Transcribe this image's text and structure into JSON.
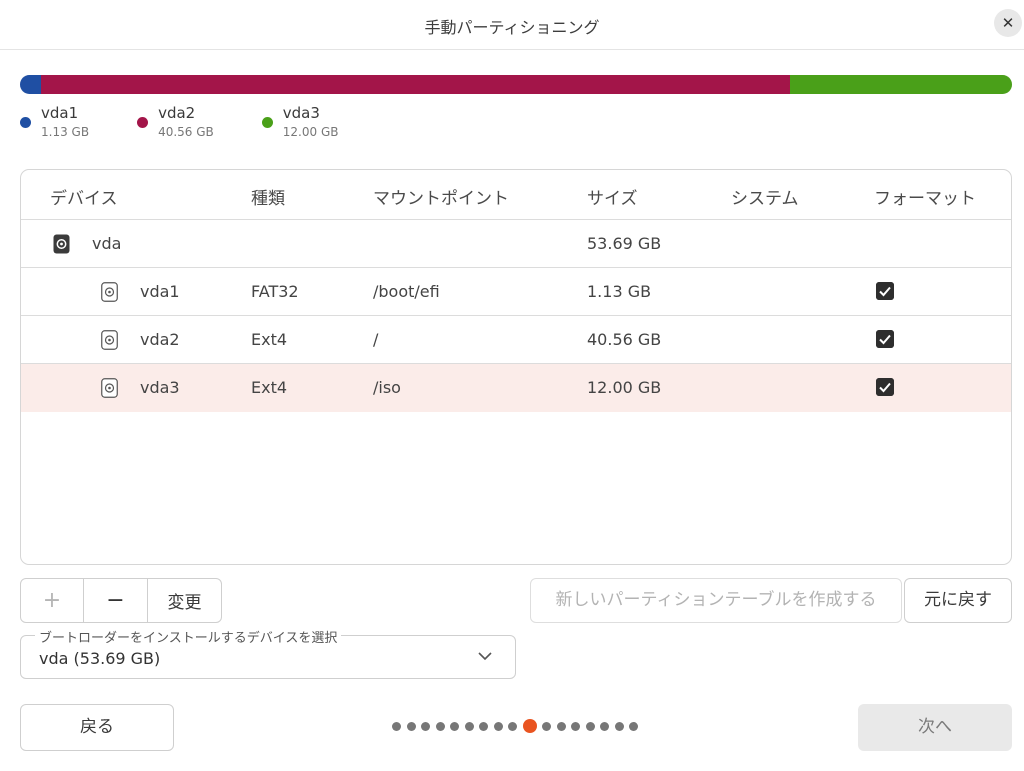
{
  "window": {
    "title": "手動パーティショニング",
    "close_label": "✕"
  },
  "usage": {
    "segments": [
      {
        "name": "vda1",
        "size": "1.13 GB",
        "color": "#1f4fa3",
        "fraction": 0.021
      },
      {
        "name": "vda2",
        "size": "40.56 GB",
        "color": "#a31549",
        "fraction": 0.755
      },
      {
        "name": "vda3",
        "size": "12.00 GB",
        "color": "#4aa019",
        "fraction": 0.224
      }
    ]
  },
  "table": {
    "headers": {
      "device": "デバイス",
      "type": "種類",
      "mount": "マウントポイント",
      "size": "サイズ",
      "system": "システム",
      "format": "フォーマット"
    },
    "disk": {
      "name": "vda",
      "size": "53.69 GB"
    },
    "partitions": [
      {
        "name": "vda1",
        "type": "FAT32",
        "mount": "/boot/efi",
        "size": "1.13 GB",
        "format": true,
        "selected": false
      },
      {
        "name": "vda2",
        "type": "Ext4",
        "mount": "/",
        "size": "40.56 GB",
        "format": true,
        "selected": false
      },
      {
        "name": "vda3",
        "type": "Ext4",
        "mount": "/iso",
        "size": "12.00 GB",
        "format": true,
        "selected": true
      }
    ]
  },
  "toolbar": {
    "add_label": "+",
    "remove_label": "−",
    "change_label": "変更",
    "new_table_label": "新しいパーティションテーブルを作成する",
    "revert_label": "元に戻す"
  },
  "bootloader": {
    "label": "ブートローダーをインストールするデバイスを選択",
    "value": "vda  (53.69 GB)"
  },
  "nav": {
    "back_label": "戻る",
    "next_label": "次へ",
    "total_steps": 17,
    "current_step": 10
  },
  "colors": {
    "accent": "#e95420",
    "selected_row": "#fbece9"
  }
}
